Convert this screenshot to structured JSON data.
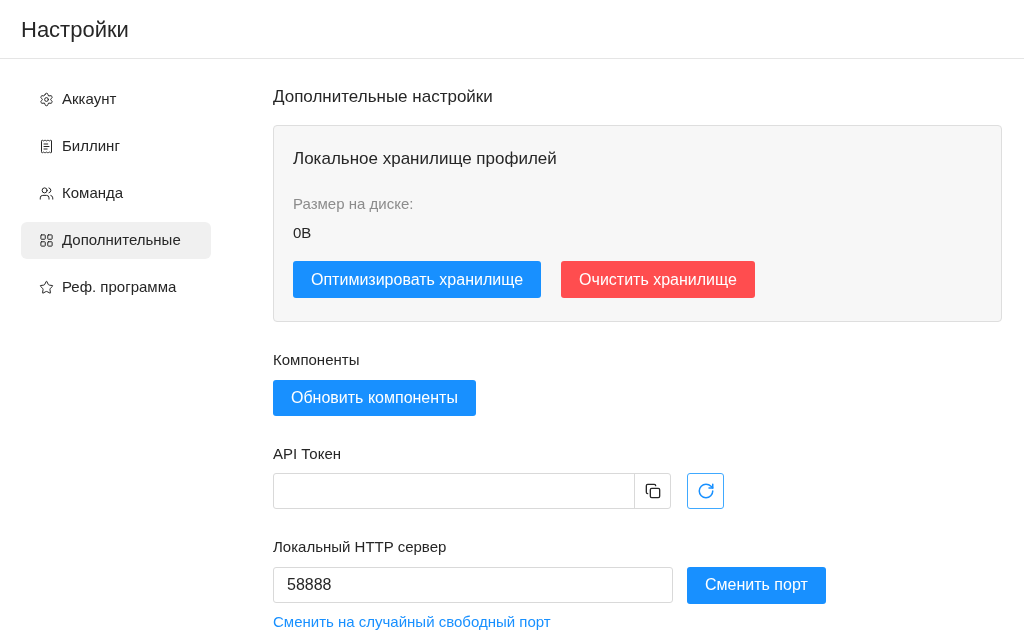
{
  "page": {
    "title": "Настройки"
  },
  "sidebar": {
    "items": [
      {
        "kind": "gear",
        "label": "Аккаунт",
        "selected": false
      },
      {
        "kind": "bill",
        "label": "Биллинг",
        "selected": false
      },
      {
        "kind": "team",
        "label": "Команда",
        "selected": false
      },
      {
        "kind": "apps",
        "label": "Дополнительные",
        "selected": true
      },
      {
        "kind": "star",
        "label": "Реф. программа",
        "selected": false
      }
    ]
  },
  "section": {
    "title": "Дополнительные настройки"
  },
  "storage_card": {
    "title": "Локальное хранилище профилей",
    "size_label": "Размер на диске:",
    "size_value": "0B",
    "buttons": [
      {
        "kind": "primary",
        "label": "Оптимизировать хранилище"
      },
      {
        "kind": "danger",
        "label": "Очистить хранилище"
      }
    ]
  },
  "components": {
    "label": "Компоненты",
    "button": "Обновить компоненты"
  },
  "api_token": {
    "label": "API Токен"
  },
  "http_server": {
    "label": "Локальный HTTP сервер",
    "value": "58888",
    "button": "Сменить порт",
    "link": "Сменить на случайный свободный порт"
  }
}
